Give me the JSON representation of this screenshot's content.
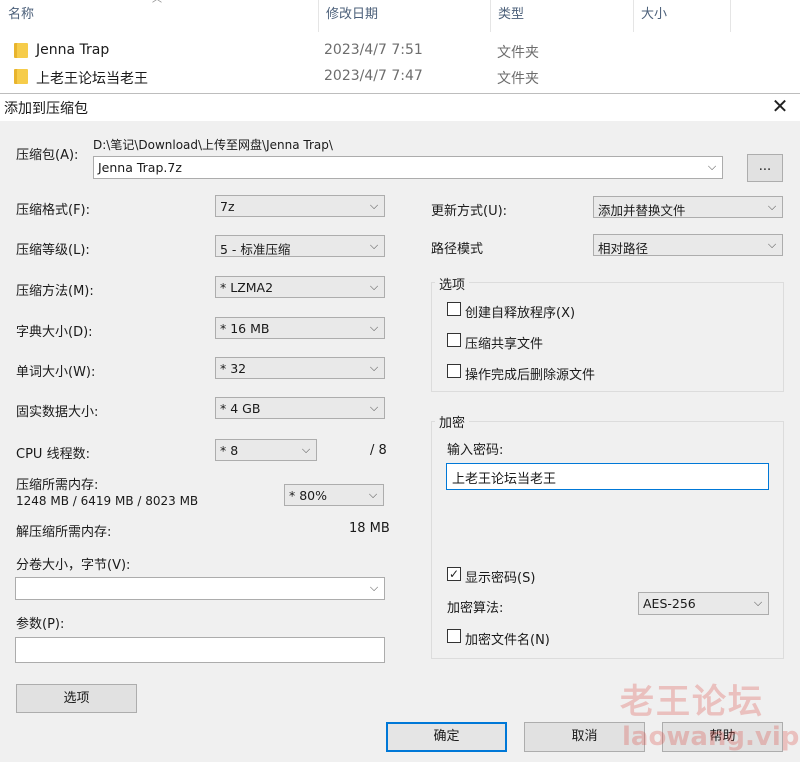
{
  "explorer": {
    "columns": [
      "名称",
      "修改日期",
      "类型",
      "大小"
    ],
    "rows": [
      {
        "name": "Jenna Trap",
        "date": "2023/4/7 7:51",
        "type": "文件夹"
      },
      {
        "name": "上老王论坛当老王",
        "date": "2023/4/7 7:47",
        "type": "文件夹"
      }
    ]
  },
  "dialog": {
    "title": "添加到压缩包",
    "archive": {
      "label": "压缩包(A):",
      "path": "D:\\笔记\\Download\\上传至网盘\\Jenna Trap\\",
      "value": "Jenna Trap.7z",
      "browse_label": "..."
    },
    "left_fields": [
      {
        "label": "压缩格式(F):",
        "value": "7z"
      },
      {
        "label": "压缩等级(L):",
        "value": "5 - 标准压缩"
      },
      {
        "label": "压缩方法(M):",
        "value": "* LZMA2"
      },
      {
        "label": "字典大小(D):",
        "value": "* 16 MB"
      },
      {
        "label": "单词大小(W):",
        "value": "* 32"
      },
      {
        "label": "固实数据大小:",
        "value": "* 4 GB"
      }
    ],
    "cpu": {
      "label": "CPU 线程数:",
      "value": "* 8",
      "max": "/ 8"
    },
    "mem": {
      "label": "压缩所需内存:",
      "detail": "1248 MB / 6419 MB / 8023 MB",
      "value": "* 80%"
    },
    "decomp": {
      "label": "解压缩所需内存:",
      "value": "18 MB"
    },
    "volume": {
      "label": "分卷大小，字节(V):",
      "value": ""
    },
    "params": {
      "label": "参数(P):",
      "value": ""
    },
    "options_button": "选项",
    "update": {
      "label": "更新方式(U):",
      "value": "添加并替换文件"
    },
    "pathmode": {
      "label": "路径模式",
      "value": "相对路径"
    },
    "options_group": {
      "title": "选项",
      "items": [
        {
          "label": "创建自释放程序(X)",
          "checked": false
        },
        {
          "label": "压缩共享文件",
          "checked": false
        },
        {
          "label": "操作完成后删除源文件",
          "checked": false
        }
      ]
    },
    "encryption": {
      "title": "加密",
      "password_label": "输入密码:",
      "password_value": "上老王论坛当老王",
      "show_password": {
        "label": "显示密码(S)",
        "checked": true
      },
      "method_label": "加密算法:",
      "method_value": "AES-256",
      "encrypt_names": {
        "label": "加密文件名(N)",
        "checked": false
      }
    },
    "buttons": {
      "ok": "确定",
      "cancel": "取消",
      "help": "帮助"
    },
    "check_glyph": "✓",
    "arrow_glyph": "⌵"
  },
  "watermark": {
    "line1": "老王论坛",
    "line2": "laowang.vip"
  },
  "colors": {
    "accent": "#0078d7",
    "folder": "#f6cc4a"
  }
}
